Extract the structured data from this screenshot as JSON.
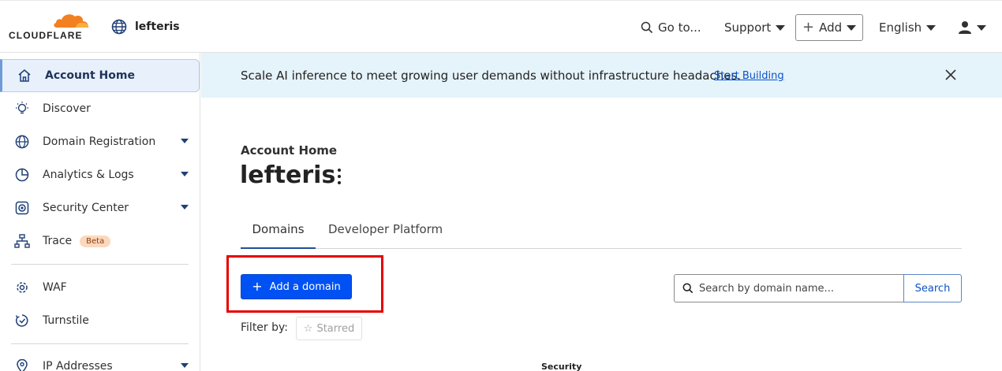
{
  "brand": {
    "wordmark": "CLOUDFLARE",
    "accent": "#f38020"
  },
  "account": {
    "name": "lefteris"
  },
  "topbar": {
    "goto_label": "Go to...",
    "support_label": "Support",
    "add_label": "Add",
    "language_label": "English"
  },
  "sidebar": {
    "items": [
      {
        "label": "Account Home",
        "icon": "home-icon"
      },
      {
        "label": "Discover",
        "icon": "lightbulb-icon"
      },
      {
        "label": "Domain Registration",
        "icon": "globe-icon"
      },
      {
        "label": "Analytics & Logs",
        "icon": "pie-chart-icon"
      },
      {
        "label": "Security Center",
        "icon": "security-icon"
      },
      {
        "label": "Trace",
        "icon": "trace-icon",
        "badge": "Beta"
      },
      {
        "label": "WAF",
        "icon": "waf-icon"
      },
      {
        "label": "Turnstile",
        "icon": "turnstile-icon"
      },
      {
        "label": "IP Addresses",
        "icon": "location-pin-icon"
      }
    ]
  },
  "banner": {
    "message": "Scale AI inference to meet growing user demands without infrastructure headaches.",
    "link_label": "Start Building"
  },
  "main": {
    "eyebrow": "Account Home",
    "title": "lefteris",
    "tabs": [
      {
        "label": "Domains"
      },
      {
        "label": "Developer Platform"
      }
    ],
    "add_domain_label": "Add a domain",
    "search": {
      "placeholder": "Search by domain name...",
      "button_label": "Search"
    },
    "filter_label": "Filter by:",
    "starred_label": "Starred",
    "column_security": "Security"
  }
}
